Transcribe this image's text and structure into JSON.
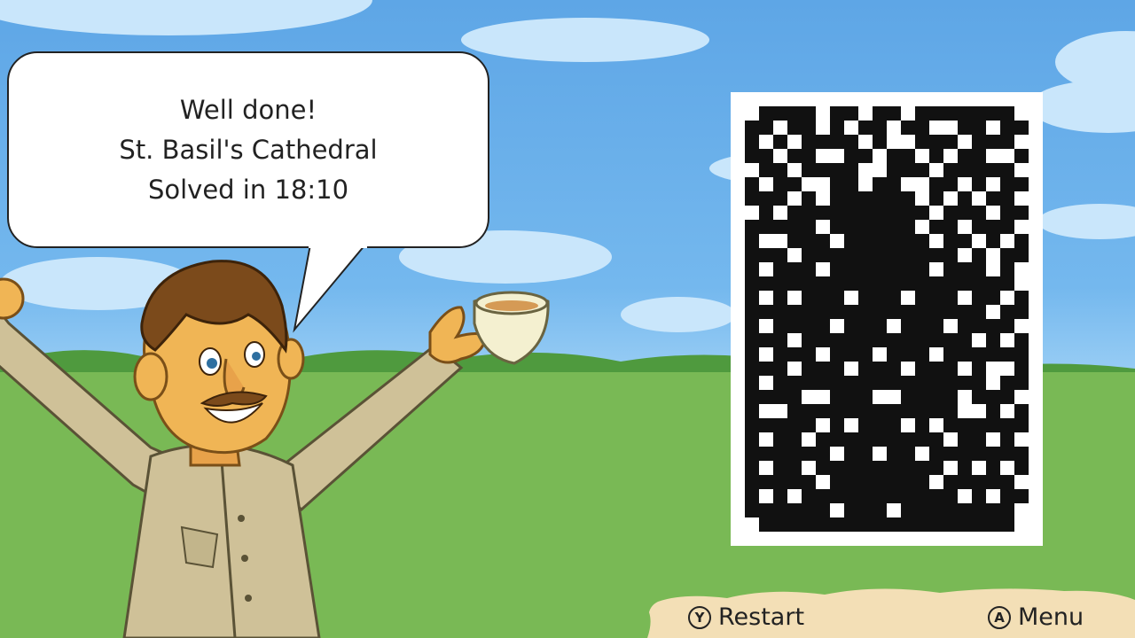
{
  "dialog": {
    "line1": "Well done!",
    "line2": "St. Basil's Cathedral",
    "line3": "Solved in 18:10"
  },
  "puzzle": {
    "name": "St. Basil's Cathedral",
    "solve_time": "18:10",
    "grid_cols": 20,
    "grid_rows": 30
  },
  "controls": {
    "restart": {
      "glyph": "Y",
      "label": "Restart",
      "icon": "y-button-icon"
    },
    "menu": {
      "glyph": "A",
      "label": "Menu",
      "icon": "a-button-icon"
    }
  },
  "colors": {
    "sky": "#5ea6e6",
    "cloud": "#c9e6fb",
    "grass": "#79b955",
    "hills": "#4f9a3e",
    "parchment": "#f3dfb6",
    "pixel": "#111111"
  }
}
